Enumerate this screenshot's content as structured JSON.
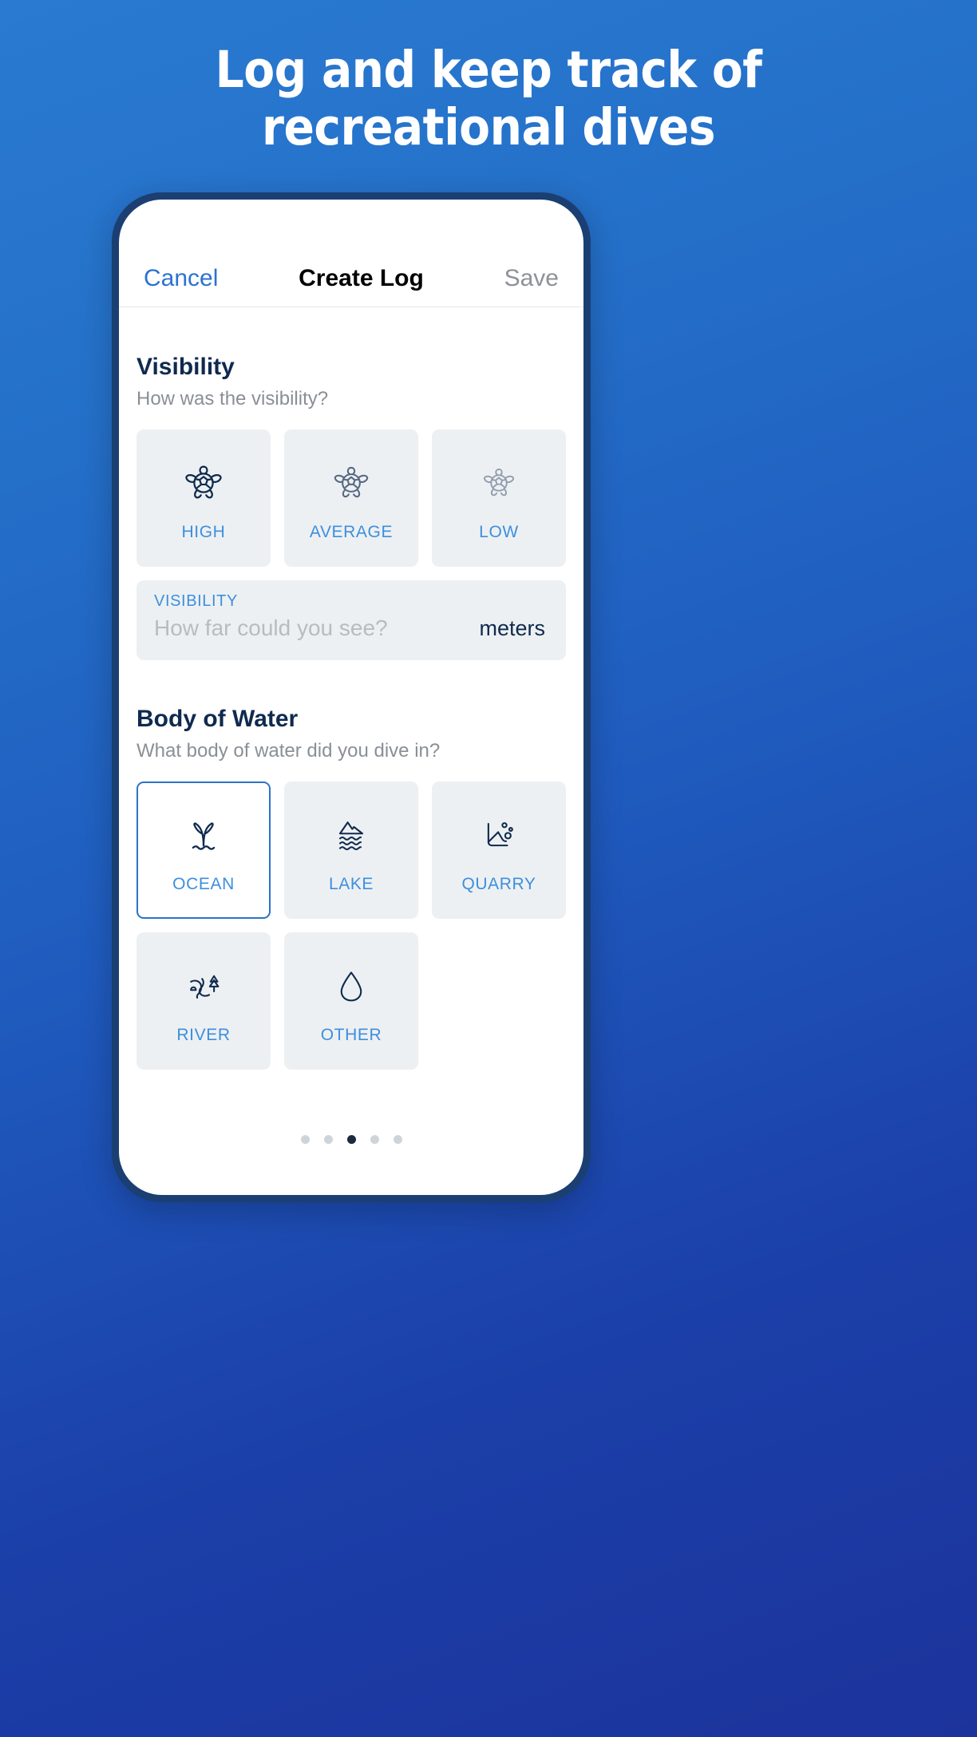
{
  "headline": {
    "line1": "Log and keep track of",
    "line2": "recreational dives"
  },
  "navbar": {
    "cancel_label": "Cancel",
    "title": "Create Log",
    "save_label": "Save"
  },
  "visibility_section": {
    "title": "Visibility",
    "subtitle": "How was the visibility?",
    "options": [
      {
        "label": "HIGH",
        "icon": "turtle-icon",
        "selected": false,
        "icon_opacity": 1.0
      },
      {
        "label": "AVERAGE",
        "icon": "turtle-icon",
        "selected": false,
        "icon_opacity": 0.68
      },
      {
        "label": "LOW",
        "icon": "turtle-icon",
        "selected": false,
        "icon_opacity": 0.42
      }
    ],
    "field": {
      "label": "VISIBILITY",
      "placeholder": "How far could you see?",
      "value": "",
      "unit": "meters"
    }
  },
  "body_of_water_section": {
    "title": "Body of Water",
    "subtitle": "What body of water did you dive in?",
    "options": [
      {
        "label": "OCEAN",
        "icon": "whale-tail-icon",
        "selected": true
      },
      {
        "label": "LAKE",
        "icon": "mountain-lake-icon",
        "selected": false
      },
      {
        "label": "QUARRY",
        "icon": "quarry-icon",
        "selected": false
      },
      {
        "label": "RIVER",
        "icon": "river-tree-icon",
        "selected": false
      },
      {
        "label": "OTHER",
        "icon": "water-drop-icon",
        "selected": false
      }
    ]
  },
  "pager": {
    "total": 5,
    "active_index": 2
  },
  "colors": {
    "background_top": "#2a7ad1",
    "background_bottom": "#1c339c",
    "phone_frame": "#1b3f72",
    "accent_blue": "#2b72d0",
    "label_blue": "#3d8fdd",
    "heading_navy": "#0f2a4e",
    "tile_bg": "#edf0f2",
    "muted_text": "#8a8f95",
    "save_disabled": "#8d9297"
  }
}
